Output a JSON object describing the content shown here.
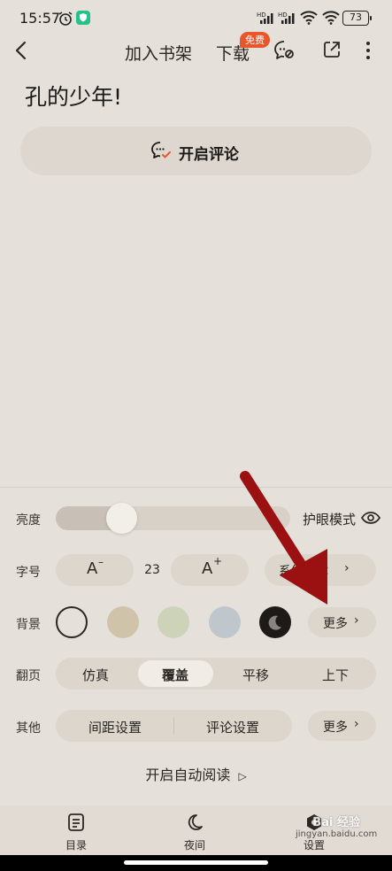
{
  "status": {
    "time": "15:57",
    "battery": "73"
  },
  "topbar": {
    "add_shelf": "加入书架",
    "download": "下载",
    "free_badge": "免费"
  },
  "book": {
    "title": "孔的少年!"
  },
  "comment": {
    "label": "开启评论"
  },
  "panel": {
    "brightness": {
      "label": "亮度",
      "value": 0.28,
      "eye_mode": "护眼模式"
    },
    "font_size": {
      "label": "字号",
      "decrease": "A",
      "value": "23",
      "increase": "A",
      "font_button": "系统字体"
    },
    "background": {
      "label": "背景",
      "swatches": [
        "#e5e0d9",
        "#cfc4a9",
        "#ccd3b8",
        "#c0c7cc",
        "#1d1a18"
      ],
      "more": "更多"
    },
    "page_turn": {
      "label": "翻页",
      "options": [
        "仿真",
        "覆盖",
        "平移",
        "上下"
      ],
      "selected": "覆盖"
    },
    "other": {
      "label": "其他",
      "spacing": "间距设置",
      "comment_settings": "评论设置",
      "more": "更多"
    },
    "auto_read": "开启自动阅读"
  },
  "bottom_nav": {
    "catalog": "目录",
    "night": "夜间",
    "settings": "设置"
  },
  "watermark": {
    "text": "Bai 经验",
    "sub": "jingyan.baidu.com"
  },
  "colors": {
    "accent_arrow": "#9b1010",
    "badge": "#e8572b"
  }
}
